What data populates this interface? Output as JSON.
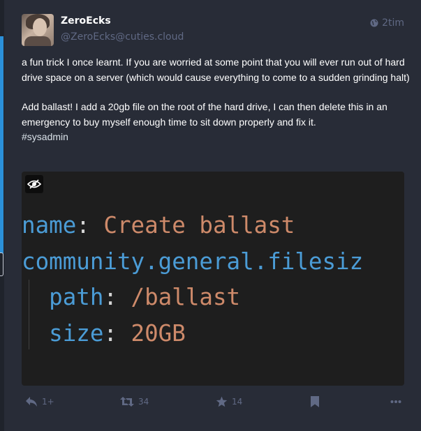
{
  "status": {
    "display_name": "ZeroEcks",
    "acct": "@ZeroEcks@cuties.cloud",
    "timestamp": "2tim",
    "visibility_icon": "globe-icon",
    "content": {
      "paragraph1": "a fun trick I once learnt. If you are worried at some point that you will ever run out of hard drive space on a server (which would cause everything to come to a sudden grinding halt)",
      "paragraph2": "Add ballast! I add a 20gb file on the root of the hard drive, I can then delete this in an emergency to buy myself enough time to sit down properly and fix it.",
      "hashtag": "#sysadmin"
    },
    "media": {
      "hide_icon": "eye-slash-icon",
      "code_lines": [
        {
          "key": "name",
          "sep": ": ",
          "value": "Create ballast"
        },
        {
          "key": "community.general.filesiz",
          "sep": "",
          "value": ""
        },
        {
          "key": "  path",
          "sep": ": ",
          "value": "/ballast"
        },
        {
          "key": "  size",
          "sep": ": ",
          "value": "20GB"
        }
      ]
    },
    "actions": {
      "reply_count": "1+",
      "reblog_count": "34",
      "favourite_count": "14"
    }
  },
  "colors": {
    "background": "#282c37",
    "muted": "#606984",
    "code_key": "#4b9cd6",
    "code_value": "#ce8a6a"
  }
}
